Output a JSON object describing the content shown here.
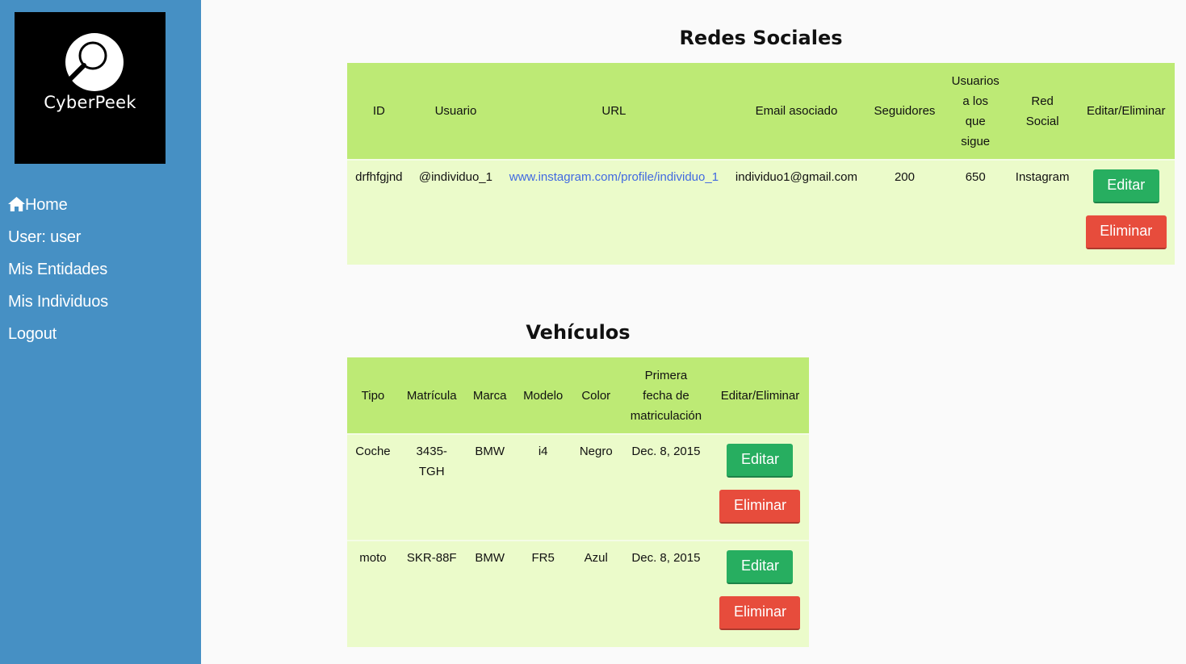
{
  "sidebar": {
    "logo": {
      "text": "CyberPeek",
      "icon": "magnifier-icon"
    },
    "nav": [
      {
        "label": "Home",
        "icon": "home-icon"
      },
      {
        "label": "User: user"
      },
      {
        "label": "Mis Entidades"
      },
      {
        "label": "Mis Individuos"
      },
      {
        "label": "Logout"
      }
    ]
  },
  "social": {
    "title": "Redes Sociales",
    "headers": [
      "ID",
      "Usuario",
      "URL",
      "Email asociado",
      "Seguidores",
      "Usuarios a los que sigue",
      "Red Social",
      "Editar/Eliminar"
    ],
    "rows": [
      {
        "id": "drfhfgjnd",
        "usuario": "@individuo_1",
        "url": "www.instagram.com/profile/individuo_1",
        "email": "individuo1@gmail.com",
        "seguidores": "200",
        "siguiendo": "650",
        "red": "Instagram"
      }
    ]
  },
  "vehicles": {
    "title": "Vehículos",
    "headers": [
      "Tipo",
      "Matrícula",
      "Marca",
      "Modelo",
      "Color",
      "Primera fecha de matriculación",
      "Editar/Eliminar"
    ],
    "rows": [
      {
        "tipo": "Coche",
        "matricula": "3435-TGH",
        "marca": "BMW",
        "modelo": "i4",
        "color": "Negro",
        "fecha": "Dec. 8, 2015"
      },
      {
        "tipo": "moto",
        "matricula": "SKR-88F",
        "marca": "BMW",
        "modelo": "FR5",
        "color": "Azul",
        "fecha": "Dec. 8, 2015"
      }
    ]
  },
  "buttons": {
    "edit": "Editar",
    "delete": "Eliminar"
  },
  "colors": {
    "sidebar": "#4690c4",
    "header_row": "#bdea75",
    "body_row": "#ebfbca",
    "edit_button": "#27ae60",
    "delete_button": "#e74c3c",
    "link": "#4169e1"
  }
}
